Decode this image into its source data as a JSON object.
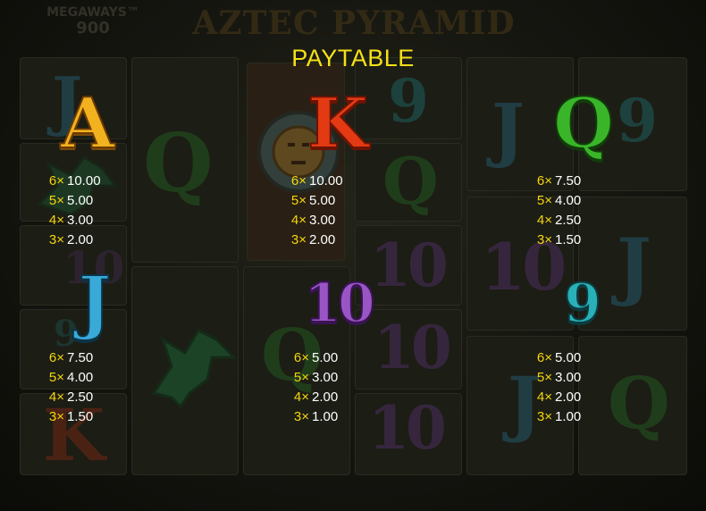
{
  "header": {
    "logo_text": "AZTEC PYRAMID",
    "megaways_label": "MEGAWAYS™",
    "megaways_number": "900"
  },
  "title": "PAYTABLE",
  "background_ghosts": [
    {
      "char": "J",
      "color": "#2f8fbf"
    },
    {
      "char": "Q",
      "color": "#2a8f2a"
    },
    {
      "char": "9",
      "color": "#20a0a5"
    },
    {
      "char": "Q",
      "color": "#2a8f2a"
    },
    {
      "char": "10",
      "color": "#7a3fa5"
    },
    {
      "char": "10",
      "color": "#7a3fa5"
    },
    {
      "char": "J",
      "color": "#2f8fbf"
    },
    {
      "char": "9",
      "color": "#20a0a5"
    },
    {
      "char": "10",
      "color": "#7a3fa5"
    },
    {
      "char": "J",
      "color": "#2f8fbf"
    },
    {
      "char": "Q",
      "color": "#2a8f2a"
    },
    {
      "char": "10",
      "color": "#7a3fa5"
    },
    {
      "char": "10",
      "color": "#7a3fa5"
    },
    {
      "char": "K",
      "color": "#c23010"
    },
    {
      "char": "J",
      "color": "#2f8fbf"
    },
    {
      "char": "Q",
      "color": "#2a8f2a"
    },
    {
      "char": "9",
      "color": "#20a0a5"
    }
  ],
  "symbols": [
    {
      "id": "A",
      "label": "A",
      "color": "#f2b21f",
      "pays": [
        {
          "m": "6×",
          "v": "10.00"
        },
        {
          "m": "5×",
          "v": "5.00"
        },
        {
          "m": "4×",
          "v": "3.00"
        },
        {
          "m": "3×",
          "v": "2.00"
        }
      ]
    },
    {
      "id": "K",
      "label": "K",
      "color": "#e33a14",
      "pays": [
        {
          "m": "6×",
          "v": "10.00"
        },
        {
          "m": "5×",
          "v": "5.00"
        },
        {
          "m": "4×",
          "v": "3.00"
        },
        {
          "m": "3×",
          "v": "2.00"
        }
      ]
    },
    {
      "id": "Q",
      "label": "Q",
      "color": "#3ab52a",
      "pays": [
        {
          "m": "6×",
          "v": "7.50"
        },
        {
          "m": "5×",
          "v": "4.00"
        },
        {
          "m": "4×",
          "v": "2.50"
        },
        {
          "m": "3×",
          "v": "1.50"
        }
      ]
    },
    {
      "id": "J",
      "label": "J",
      "color": "#39a9d8",
      "pays": [
        {
          "m": "6×",
          "v": "7.50"
        },
        {
          "m": "5×",
          "v": "4.00"
        },
        {
          "m": "4×",
          "v": "2.50"
        },
        {
          "m": "3×",
          "v": "1.50"
        }
      ]
    },
    {
      "id": "10",
      "label": "10",
      "color": "#9a55c5",
      "pays": [
        {
          "m": "6×",
          "v": "5.00"
        },
        {
          "m": "5×",
          "v": "3.00"
        },
        {
          "m": "4×",
          "v": "2.00"
        },
        {
          "m": "3×",
          "v": "1.00"
        }
      ]
    },
    {
      "id": "9",
      "label": "9",
      "color": "#2ab0b7",
      "pays": [
        {
          "m": "6×",
          "v": "5.00"
        },
        {
          "m": "5×",
          "v": "3.00"
        },
        {
          "m": "4×",
          "v": "2.00"
        },
        {
          "m": "3×",
          "v": "1.00"
        }
      ]
    }
  ]
}
